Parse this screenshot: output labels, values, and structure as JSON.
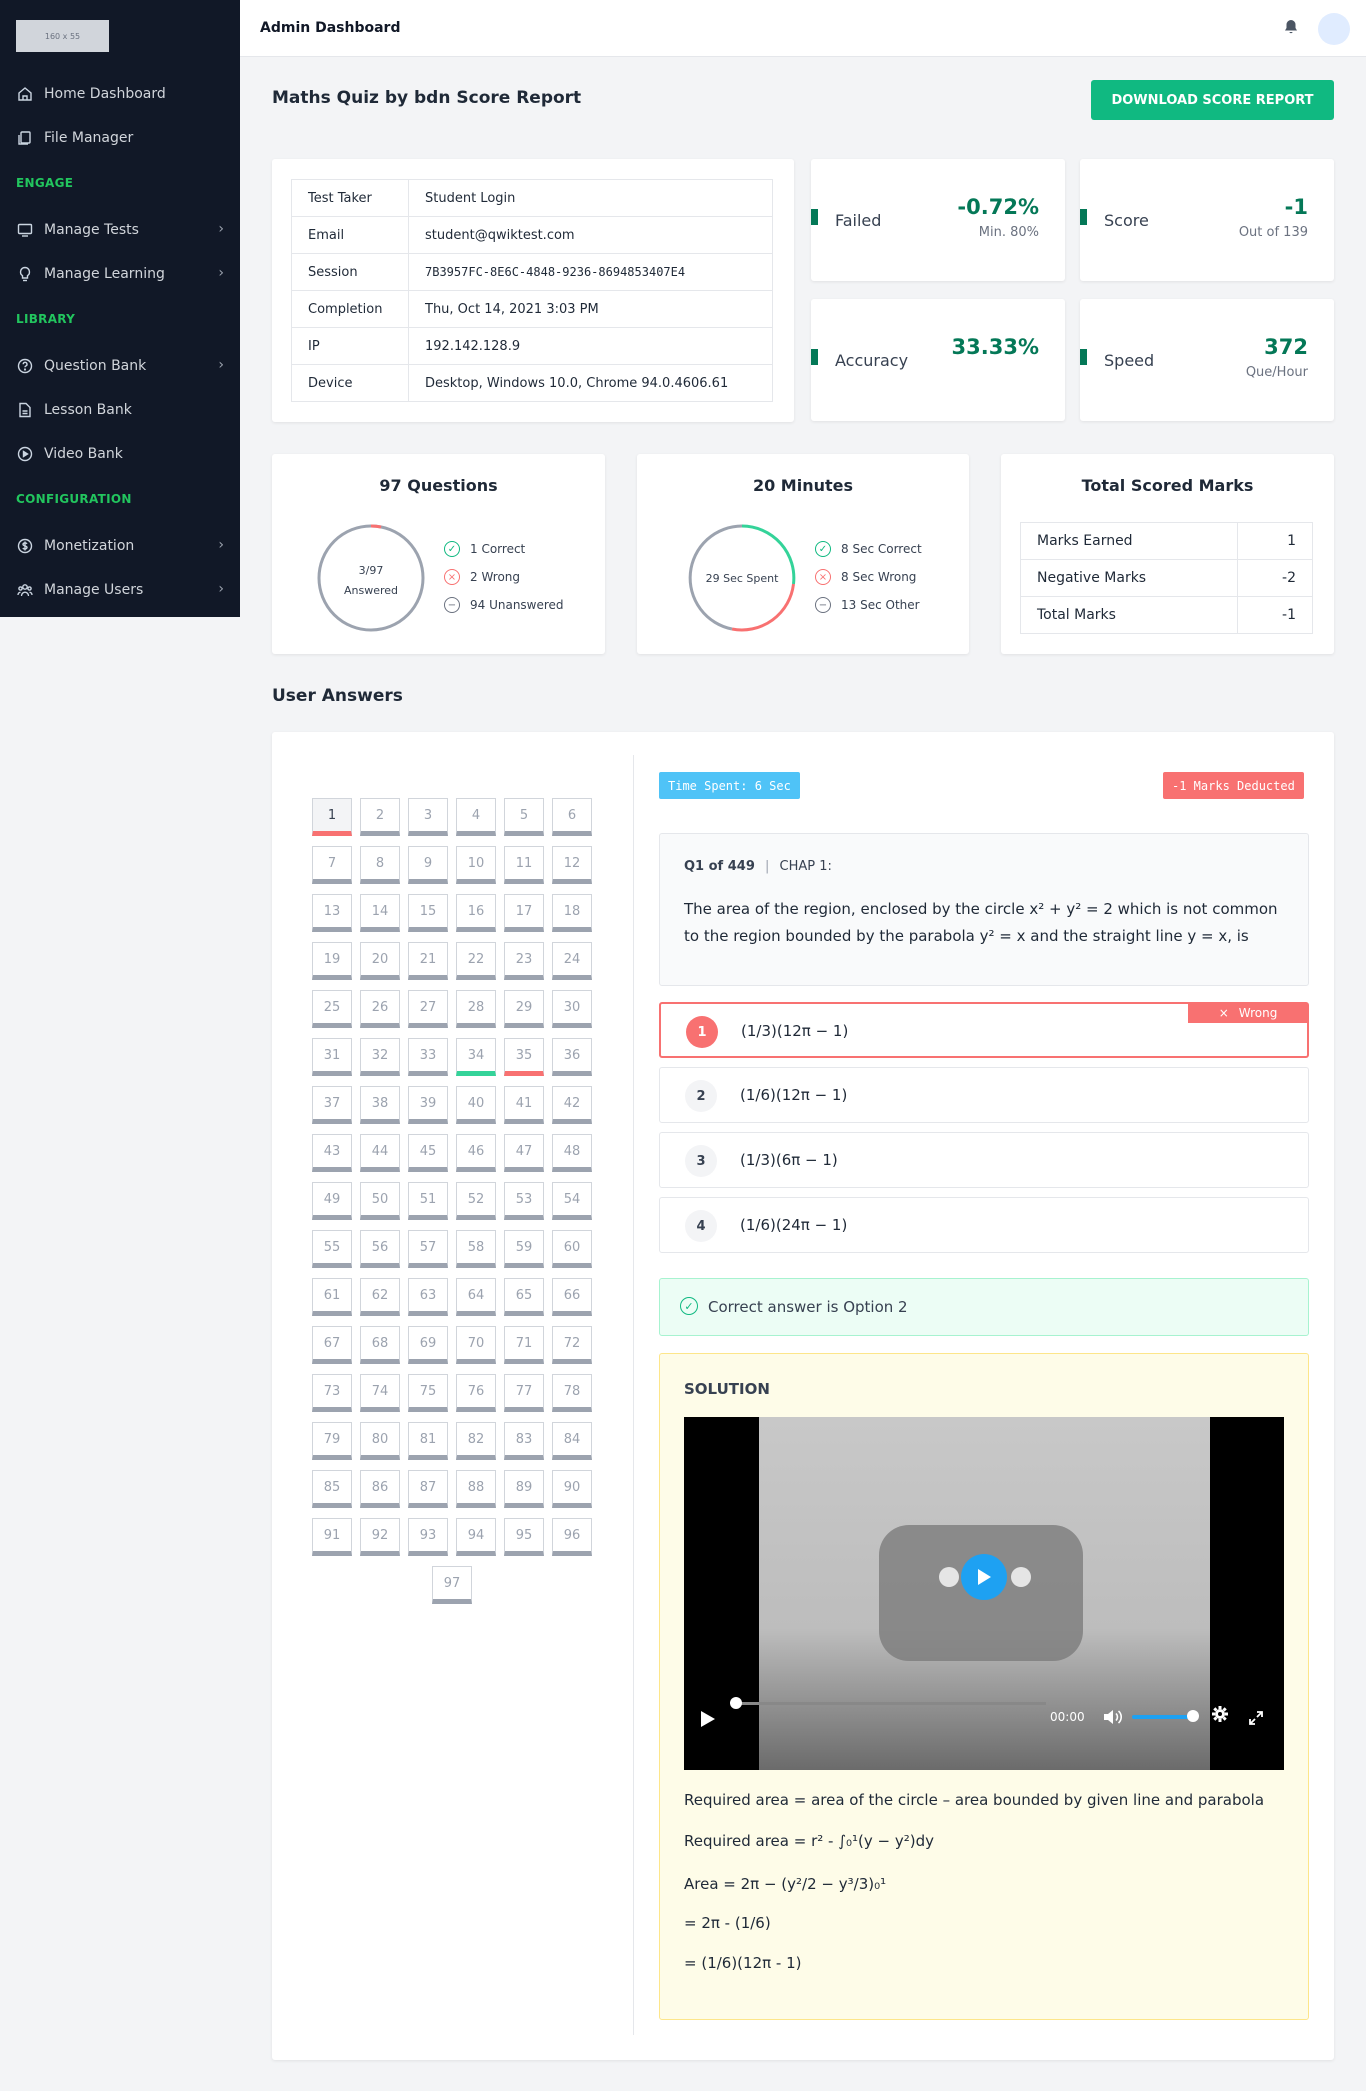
{
  "sidebar": {
    "logo_text": "160 x 55",
    "items": [
      {
        "label": "Home Dashboard"
      },
      {
        "label": "File Manager"
      },
      {
        "label": "Manage Tests"
      },
      {
        "label": "Manage Learning"
      },
      {
        "label": "Question Bank"
      },
      {
        "label": "Lesson Bank"
      },
      {
        "label": "Video Bank"
      },
      {
        "label": "Monetization"
      },
      {
        "label": "Manage Users"
      }
    ],
    "sections": [
      "ENGAGE",
      "LIBRARY",
      "CONFIGURATION"
    ]
  },
  "topbar": {
    "title": "Admin Dashboard"
  },
  "page": {
    "title": "Maths Quiz by bdn Score Report",
    "download_label": "DOWNLOAD SCORE REPORT"
  },
  "info": {
    "rows": [
      {
        "k": "Test Taker",
        "v": "Student Login"
      },
      {
        "k": "Email",
        "v": "student@qwiktest.com"
      },
      {
        "k": "Session",
        "v": "7B3957FC-8E6C-4848-9236-8694853407E4"
      },
      {
        "k": "Completion",
        "v": "Thu, Oct 14, 2021 3:03 PM"
      },
      {
        "k": "IP",
        "v": "192.142.128.9"
      },
      {
        "k": "Device",
        "v": "Desktop, Windows 10.0, Chrome 94.0.4606.61"
      }
    ]
  },
  "stats": {
    "failed": {
      "label": "Failed",
      "value": "-0.72%",
      "sub": "Min. 80%"
    },
    "score": {
      "label": "Score",
      "value": "-1",
      "sub": "Out of 139"
    },
    "accuracy": {
      "label": "Accuracy",
      "value": "33.33%"
    },
    "speed": {
      "label": "Speed",
      "value": "372",
      "sub": "Que/Hour"
    }
  },
  "summary": {
    "questions": {
      "title": "97 Questions",
      "center1": "3/97",
      "center2": "Answered",
      "answered_fraction": 0.031,
      "legend": [
        "1 Correct",
        "2 Wrong",
        "94 Unanswered"
      ]
    },
    "minutes": {
      "title": "20 Minutes",
      "center": "29 Sec Spent",
      "legend": [
        "8 Sec Correct",
        "8 Sec Wrong",
        "13 Sec Other"
      ]
    },
    "marks": {
      "title": "Total Scored Marks",
      "rows": [
        {
          "k": "Marks Earned",
          "v": "1"
        },
        {
          "k": "Negative Marks",
          "v": "-2"
        },
        {
          "k": "Total Marks",
          "v": "-1"
        }
      ]
    }
  },
  "answers": {
    "title": "User Answers",
    "total": 97,
    "current": 1,
    "wrong": [
      1,
      35
    ],
    "correct": [
      34
    ],
    "time_spent": "Time Spent: 6 Sec",
    "marks_deducted": "-1 Marks Deducted",
    "q_number": "Q1 of 449",
    "q_chapter": "CHAP 1:",
    "question": "The area of the region, enclosed by the circle x² + y² = 2 which is not common to the region bounded by the parabola y² = x and the straight line y = x, is",
    "options": [
      "(1/3)(12π − 1)",
      "(1/6)(12π − 1)",
      "(1/3)(6π − 1)",
      "(1/6)(24π − 1)"
    ],
    "option_nums": [
      "1",
      "2",
      "3",
      "4"
    ],
    "wrong_label": "Wrong",
    "correct_text": "Correct answer is Option 2",
    "solution_title": "SOLUTION",
    "video_time": "00:00",
    "solution_lines": [
      "Required area = area of the circle – area bounded by given line and parabola",
      "Required area = r² - ∫₀¹(y − y²)dy",
      "Area = 2π − (y²/2 − y³/3)₀¹",
      "= 2π - (1/6)",
      "= (1/6)(12π - 1)"
    ]
  }
}
